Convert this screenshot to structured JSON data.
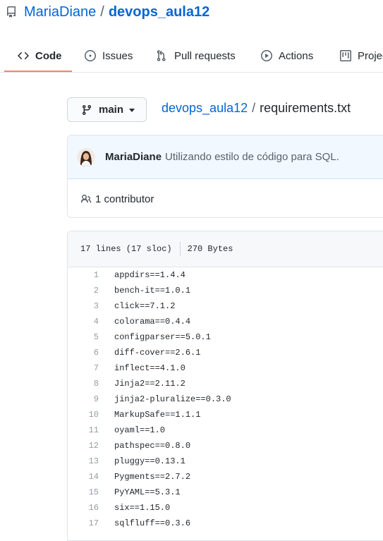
{
  "repo": {
    "owner": "MariaDiane",
    "separator": "/",
    "name": "devops_aula12",
    "icon": "repo-icon"
  },
  "tabs": [
    {
      "label": "Code",
      "icon": "code-icon",
      "active": true
    },
    {
      "label": "Issues",
      "icon": "issue-opened-icon",
      "active": false
    },
    {
      "label": "Pull requests",
      "icon": "git-pull-request-icon",
      "active": false
    },
    {
      "label": "Actions",
      "icon": "play-icon",
      "active": false
    },
    {
      "label": "Projec",
      "icon": "project-icon",
      "active": false
    }
  ],
  "branch": {
    "label": "main",
    "icon": "git-branch-icon"
  },
  "breadcrumb": {
    "repo": "devops_aula12",
    "separator": "/",
    "file": "requirements.txt"
  },
  "commit": {
    "author": "MariaDiane",
    "message": "Utilizando estilo de código para SQL."
  },
  "contributors": {
    "label": "1 contributor",
    "icon": "people-icon"
  },
  "file": {
    "lines_info": "17 lines (17 sloc)",
    "size": "270 Bytes"
  },
  "code_lines": [
    {
      "num": "1",
      "text": "appdirs==1.4.4"
    },
    {
      "num": "2",
      "text": "bench-it==1.0.1"
    },
    {
      "num": "3",
      "text": "click==7.1.2"
    },
    {
      "num": "4",
      "text": "colorama==0.4.4"
    },
    {
      "num": "5",
      "text": "configparser==5.0.1"
    },
    {
      "num": "6",
      "text": "diff-cover==2.6.1"
    },
    {
      "num": "7",
      "text": "inflect==4.1.0"
    },
    {
      "num": "8",
      "text": "Jinja2==2.11.2"
    },
    {
      "num": "9",
      "text": "jinja2-pluralize==0.3.0"
    },
    {
      "num": "10",
      "text": "MarkupSafe==1.1.1"
    },
    {
      "num": "11",
      "text": "oyaml==1.0"
    },
    {
      "num": "12",
      "text": "pathspec==0.8.0"
    },
    {
      "num": "13",
      "text": "pluggy==0.13.1"
    },
    {
      "num": "14",
      "text": "Pygments==2.7.2"
    },
    {
      "num": "15",
      "text": "PyYAML==5.3.1"
    },
    {
      "num": "16",
      "text": "six==1.15.0"
    },
    {
      "num": "17",
      "text": "sqlfluff==0.3.6"
    }
  ],
  "colors": {
    "link": "#0366d6",
    "tab_underline": "#f9826c",
    "commit_bg": "#f1f8ff"
  }
}
